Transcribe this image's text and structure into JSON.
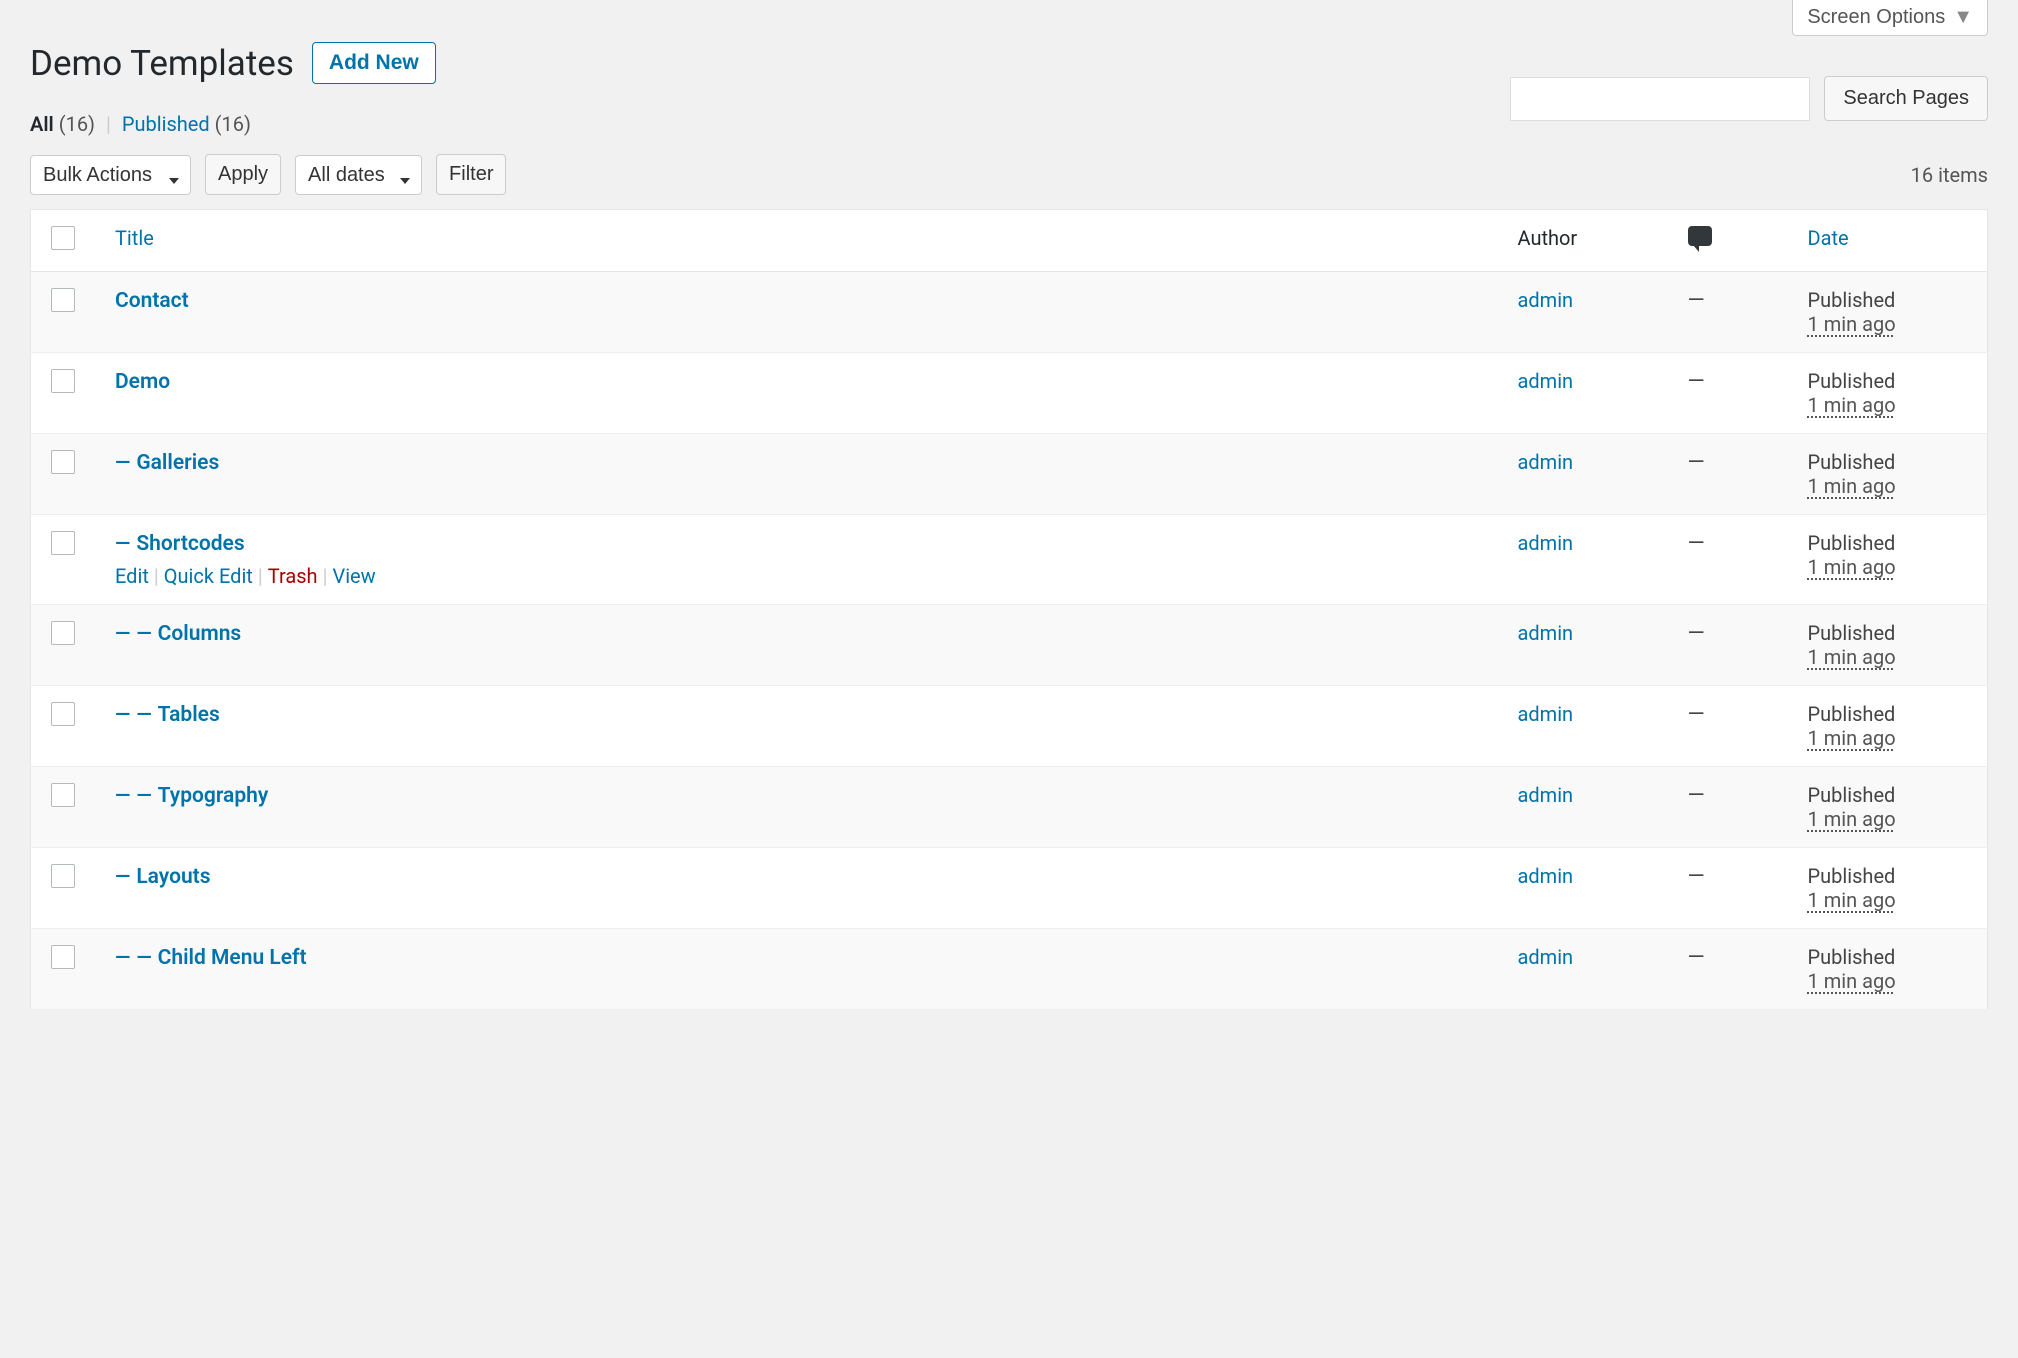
{
  "screen_options_label": "Screen Options",
  "page_heading": "Demo Templates",
  "add_new_label": "Add New",
  "filters": {
    "all_label": "All",
    "all_count": "(16)",
    "published_label": "Published",
    "published_count": "(16)"
  },
  "bulk_actions_label": "Bulk Actions",
  "apply_label": "Apply",
  "all_dates_label": "All dates",
  "filter_label": "Filter",
  "search_btn_label": "Search Pages",
  "items_count": "16 items",
  "columns": {
    "title": "Title",
    "author": "Author",
    "date": "Date"
  },
  "row_actions": {
    "edit": "Edit",
    "quick_edit": "Quick Edit",
    "trash": "Trash",
    "view": "View"
  },
  "rows": [
    {
      "indent": 0,
      "title": "Contact",
      "author": "admin",
      "comments": "—",
      "status": "Published",
      "ago": "1 min ago",
      "show_actions": false
    },
    {
      "indent": 0,
      "title": "Demo",
      "author": "admin",
      "comments": "—",
      "status": "Published",
      "ago": "1 min ago",
      "show_actions": false
    },
    {
      "indent": 1,
      "title": "Galleries",
      "author": "admin",
      "comments": "—",
      "status": "Published",
      "ago": "1 min ago",
      "show_actions": false
    },
    {
      "indent": 1,
      "title": "Shortcodes",
      "author": "admin",
      "comments": "—",
      "status": "Published",
      "ago": "1 min ago",
      "show_actions": true
    },
    {
      "indent": 2,
      "title": "Columns",
      "author": "admin",
      "comments": "—",
      "status": "Published",
      "ago": "1 min ago",
      "show_actions": false
    },
    {
      "indent": 2,
      "title": "Tables",
      "author": "admin",
      "comments": "—",
      "status": "Published",
      "ago": "1 min ago",
      "show_actions": false
    },
    {
      "indent": 2,
      "title": "Typography",
      "author": "admin",
      "comments": "—",
      "status": "Published",
      "ago": "1 min ago",
      "show_actions": false
    },
    {
      "indent": 1,
      "title": "Layouts",
      "author": "admin",
      "comments": "—",
      "status": "Published",
      "ago": "1 min ago",
      "show_actions": false
    },
    {
      "indent": 2,
      "title": "Child Menu Left",
      "author": "admin",
      "comments": "—",
      "status": "Published",
      "ago": "1 min ago",
      "show_actions": false
    }
  ]
}
